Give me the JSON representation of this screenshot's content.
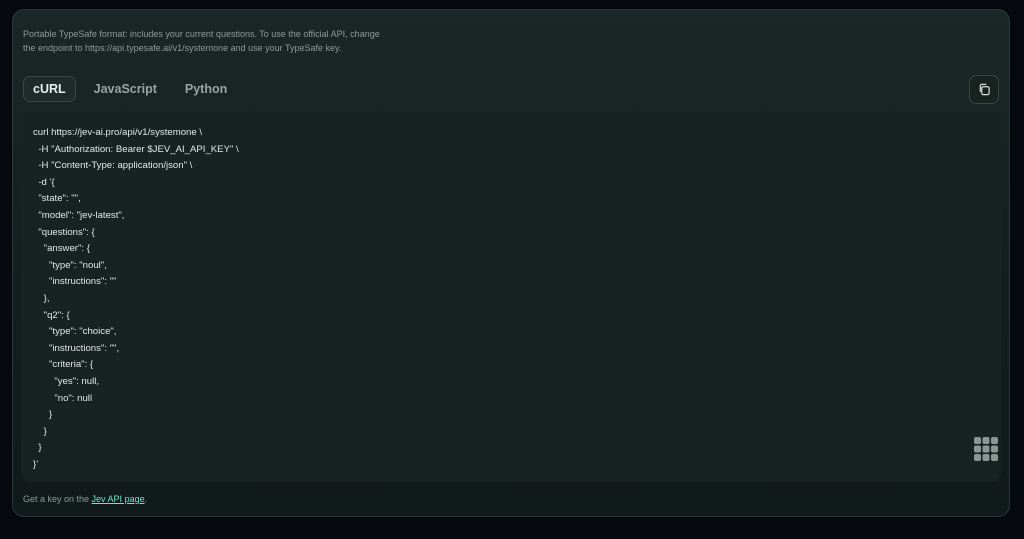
{
  "intro": {
    "text": "Portable TypeSafe format: includes your current questions. To use the official API, change the endpoint to https://api.typesafe.ai/v1/systemone and use your TypeSafe key."
  },
  "tabs": [
    {
      "label": "cURL",
      "active": true
    },
    {
      "label": "JavaScript",
      "active": false
    },
    {
      "label": "Python",
      "active": false
    }
  ],
  "icons": {
    "copy": "copy-icon",
    "grid": "grid-icon"
  },
  "code": {
    "lines": [
      "curl https://jev-ai.pro/api/v1/systemone \\",
      "  -H \"Authorization: Bearer $JEV_AI_API_KEY\" \\",
      "  -H \"Content-Type: application/json\" \\",
      "  -d '{",
      "  \"state\": \"\",",
      "  \"model\": \"jev-latest\",",
      "  \"questions\": {",
      "    \"answer\": {",
      "      \"type\": \"noul\",",
      "      \"instructions\": \"\"",
      "    },",
      "    \"q2\": {",
      "      \"type\": \"choice\",",
      "      \"instructions\": \"\",",
      "      \"criteria\": {",
      "        \"yes\": null,",
      "        \"no\": null",
      "      }",
      "    }",
      "  }",
      "}'"
    ]
  },
  "footer": {
    "prefix": "Get a key on the ",
    "link": "Jev API page",
    "suffix": "."
  },
  "colors": {
    "accent_link": "#6fe3cf",
    "card_bg": "#1b2726",
    "code_bg": "#172322"
  }
}
